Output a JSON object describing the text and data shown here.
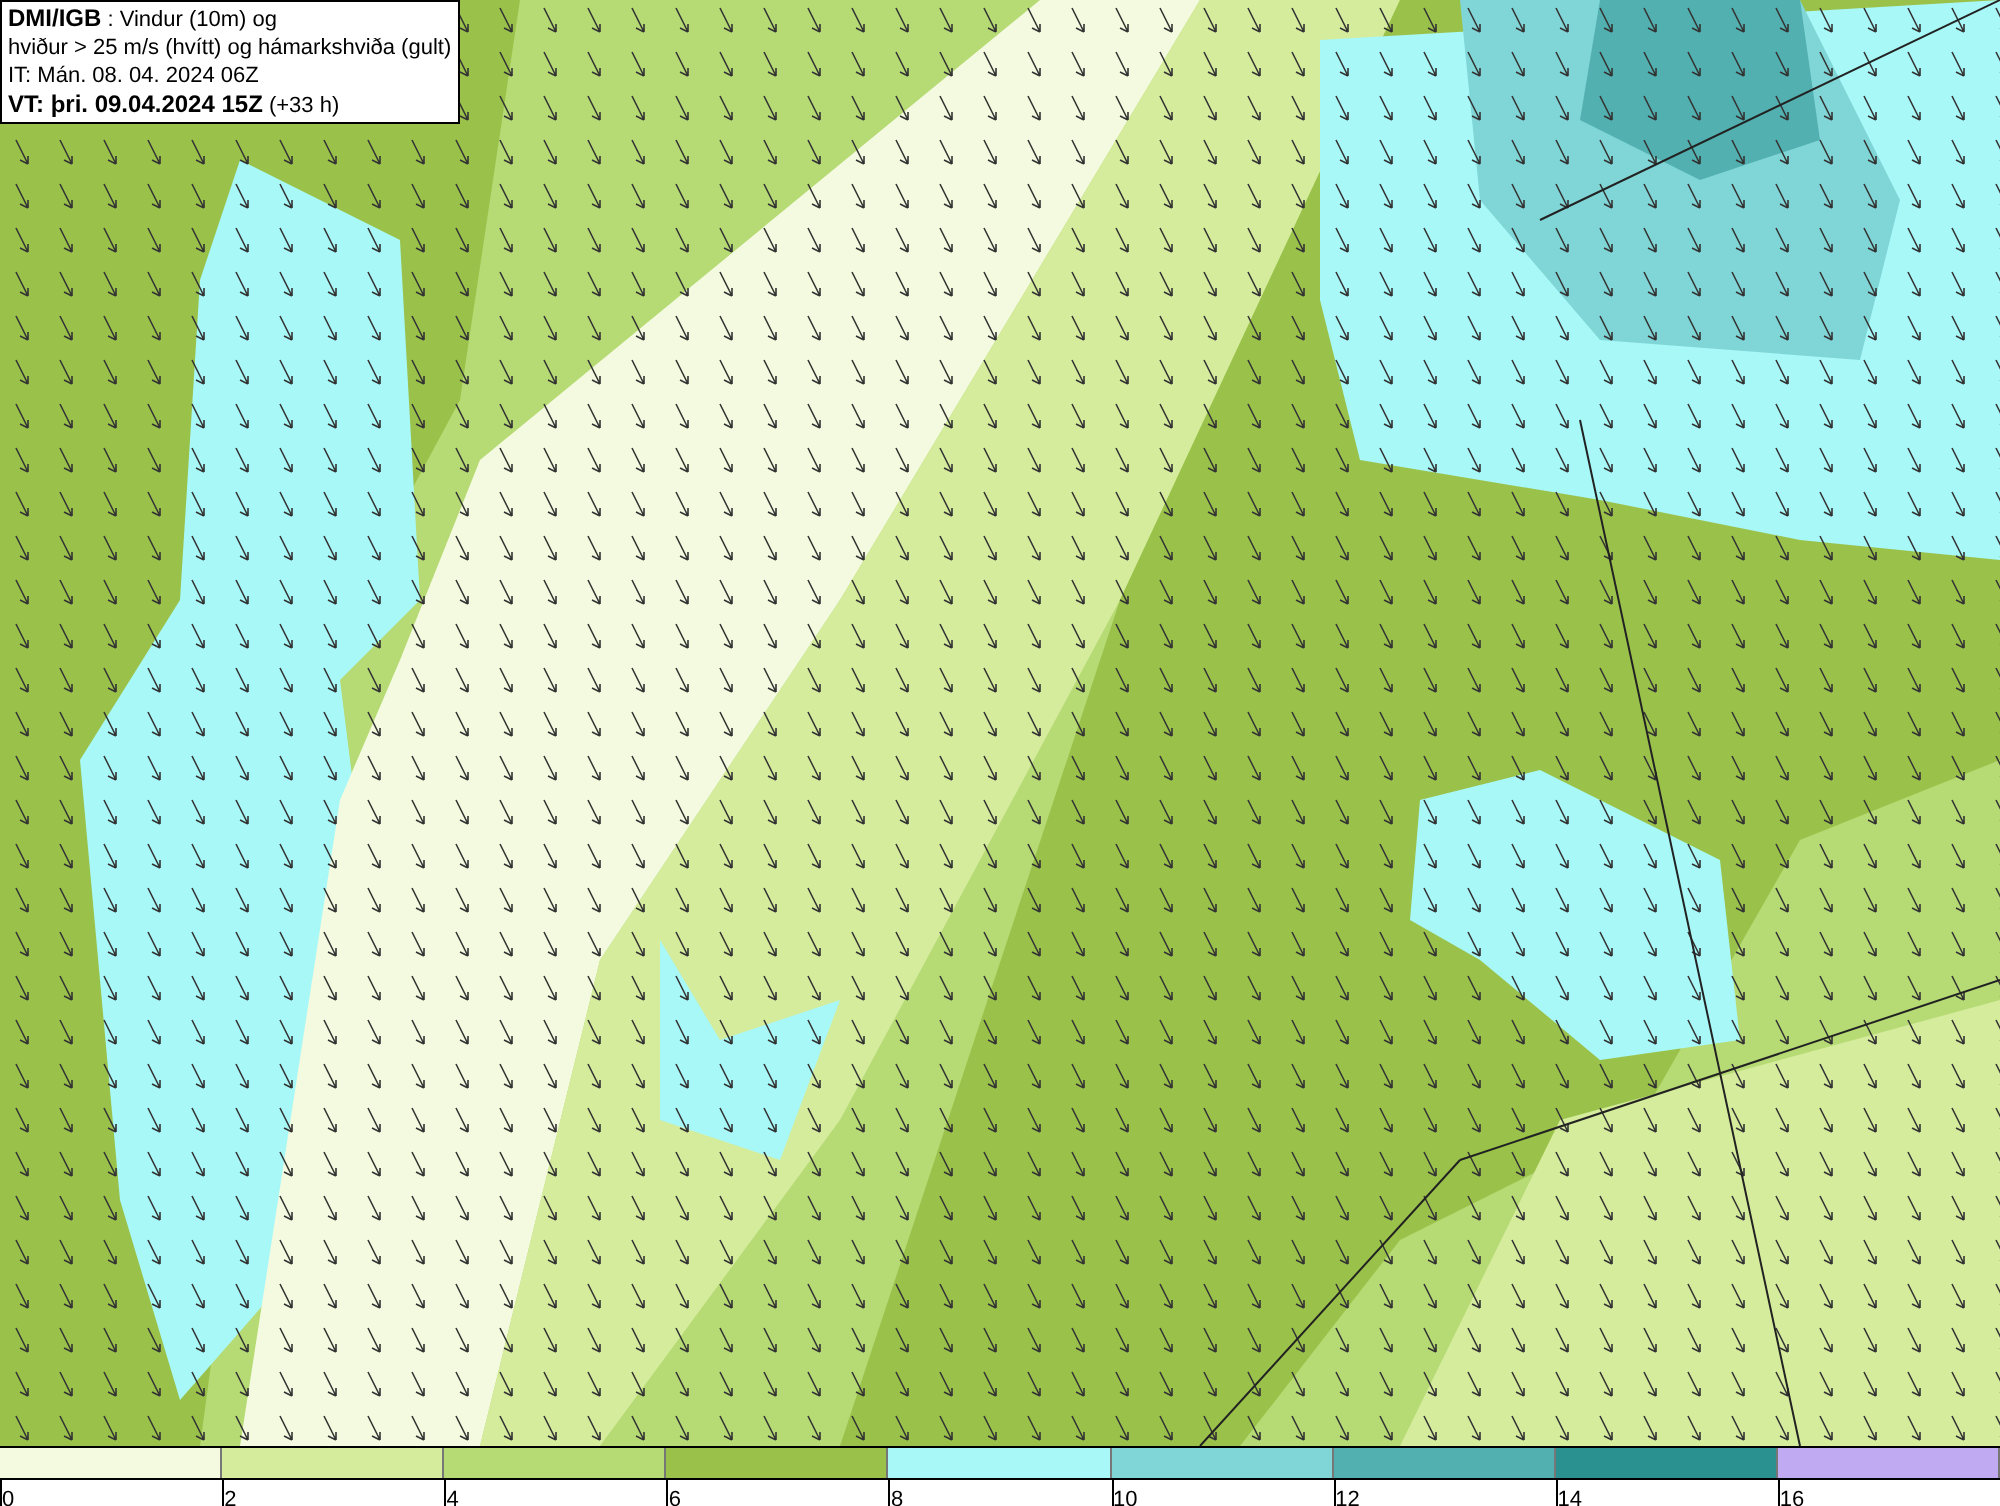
{
  "info_box": {
    "lines": [
      "**DMI/IGB** : Vindur (10m) og",
      "hviður > 25 m/s (hvítt) og hámarkshviða (gult)",
      "IT: Mán. 08. 04. 2024 06Z",
      "**VT: þri. 09.04.2024 15Z** (+33 h)"
    ]
  },
  "legend": {
    "bins": [
      {
        "color": "#f4fadf",
        "label": "0"
      },
      {
        "color": "#d4ec9c",
        "label": "2"
      },
      {
        "color": "#b6da74",
        "label": "4"
      },
      {
        "color": "#9ac24a",
        "label": "6"
      },
      {
        "color": "#a8f8f8",
        "label": "8"
      },
      {
        "color": "#80d6d6",
        "label": "10"
      },
      {
        "color": "#52b0b0",
        "label": "12"
      },
      {
        "color": "#2a9090",
        "label": "14"
      },
      {
        "color": "#c0aaf2",
        "label": "16"
      }
    ]
  }
}
